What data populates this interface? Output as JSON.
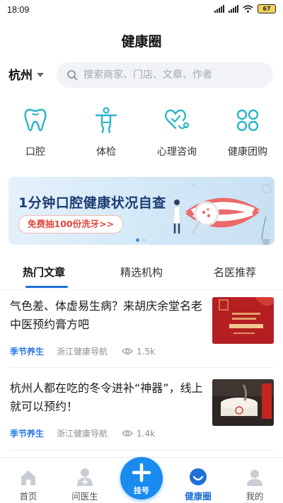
{
  "status_bar": {
    "time": "18:09",
    "battery": "67"
  },
  "header": {
    "title": "健康圈"
  },
  "location": {
    "city": "杭州"
  },
  "search": {
    "placeholder": "搜索商家、门店、文章、作者"
  },
  "categories": [
    {
      "label": "口腔",
      "icon": "tooth-icon"
    },
    {
      "label": "体检",
      "icon": "person-checkup-icon"
    },
    {
      "label": "心理咨询",
      "icon": "heart-stethoscope-icon"
    },
    {
      "label": "健康团购",
      "icon": "four-petal-icon"
    }
  ],
  "banner": {
    "title": "1分钟口腔健康状况自查",
    "cta": "免费抽100份洗牙>>",
    "slide_count": 2,
    "active_slide": 1
  },
  "tabs": [
    {
      "label": "热门文章",
      "active": true
    },
    {
      "label": "精选机构",
      "active": false
    },
    {
      "label": "名医推荐",
      "active": false
    }
  ],
  "articles": [
    {
      "title": "气色差、体虚易生病？来胡庆余堂名老中医预约膏方吧",
      "tag": "季节养生",
      "source": "浙江健康导航",
      "views": "1.5k"
    },
    {
      "title": "杭州人都在吃的冬令进补“神器”，线上就可以预约！",
      "tag": "季节养生",
      "source": "浙江健康导航",
      "views": "1.4k"
    }
  ],
  "tabbar": {
    "items": [
      {
        "label": "首页",
        "icon": "home-icon"
      },
      {
        "label": "问医生",
        "icon": "doctor-icon"
      },
      {
        "label": "挂号",
        "icon": "plus-icon"
      },
      {
        "label": "健康圈",
        "icon": "health-circle-icon",
        "active": true
      },
      {
        "label": "我的",
        "icon": "user-icon"
      }
    ]
  },
  "colors": {
    "accent": "#1f6fd8",
    "tag": "#2c7be5",
    "fab": "#1a8cf0",
    "icon_teal": "#2bb5c8"
  }
}
